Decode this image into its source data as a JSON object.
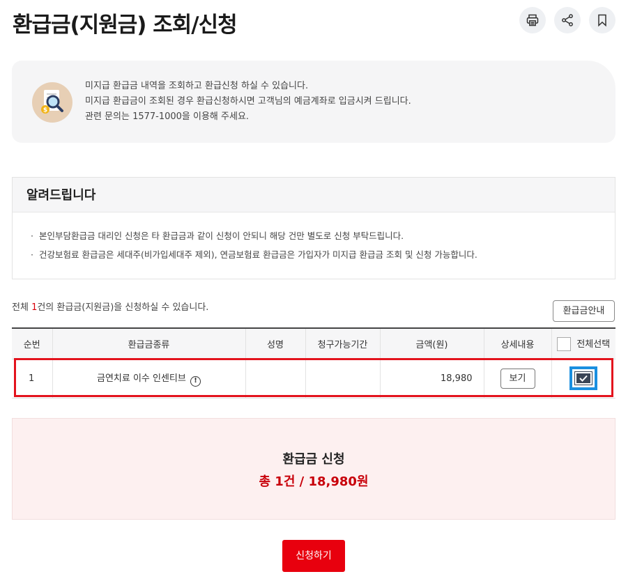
{
  "page": {
    "title": "환급금(지원금) 조회/신청"
  },
  "actions": {
    "print_icon": "printer-icon",
    "share_icon": "share-icon",
    "bookmark_icon": "bookmark-icon"
  },
  "info": {
    "icon": "magnifier-document-icon",
    "lines": [
      "미지급 환급금 내역을 조회하고 환급신청 하실 수 있습니다.",
      "미지급 환급금이 조회된 경우 환급신청하시면 고객님의 예금계좌로 입금시켜 드립니다.",
      "관련 문의는 1577-1000을 이용해 주세요."
    ]
  },
  "notice": {
    "title": "알려드립니다",
    "items": [
      "본인부담환급금 대리인 신청은 타 환급금과 같이 신청이 안되니 해당 건만 별도로 신청 부탁드립니다.",
      "건강보험료 환급금은 세대주(비가입세대주 제외), 연금보험료 환급금은 가입자가 미지급 환급금 조회 및 신청 가능합니다."
    ]
  },
  "count": {
    "prefix": "전체 ",
    "number": "1",
    "suffix": "건의 환급금(지원금)을 신청하실 수 있습니다."
  },
  "guide_button": "환급금안내",
  "table": {
    "headers": [
      "순번",
      "환급금종류",
      "성명",
      "청구가능기간",
      "금액(원)",
      "상세내용",
      "전체선택"
    ],
    "rows": [
      {
        "no": "1",
        "type": "금연치료 이수 인센티브",
        "name": "",
        "period": "",
        "amount": "18,980",
        "detail_button": "보기",
        "checked": true
      }
    ]
  },
  "summary": {
    "title": "환급금 신청",
    "total": "총 1건 / 18,980원"
  },
  "apply_button": "신청하기",
  "colors": {
    "accent_red": "#e8000e",
    "select_blue": "#1a8fe0"
  }
}
